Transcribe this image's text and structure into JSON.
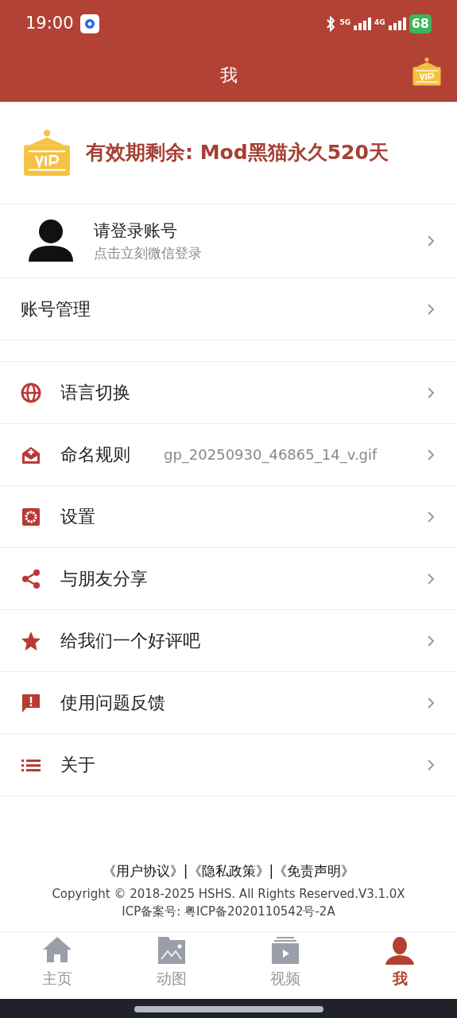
{
  "status_bar": {
    "time": "19:00",
    "networks": [
      "5G",
      "4G"
    ],
    "battery": "68"
  },
  "header": {
    "title": "我"
  },
  "vip_banner": {
    "text": "有效期剩余: Mod黑猫永久520天"
  },
  "account": {
    "title": "请登录账号",
    "subtitle": "点击立刻微信登录"
  },
  "account_manage": {
    "label": "账号管理"
  },
  "menu": [
    {
      "label": "语言切换"
    },
    {
      "label": "命名规则",
      "value": "gp_20250930_46865_14_v.gif"
    },
    {
      "label": "设置"
    },
    {
      "label": "与朋友分享"
    },
    {
      "label": "给我们一个好评吧"
    },
    {
      "label": "使用问题反馈"
    },
    {
      "label": "关于"
    }
  ],
  "footer": {
    "links": [
      "《用户协议》",
      "《隐私政策》",
      "《免责声明》"
    ],
    "separator": "|",
    "copyright": "Copyright © 2018-2025 HSHS. All Rights Reserved.V3.1.0X",
    "icp": "ICP备案号: 粤ICP备2020110542号-2A"
  },
  "tabs": [
    {
      "label": "主页",
      "selected": false
    },
    {
      "label": "动图",
      "selected": false
    },
    {
      "label": "视频",
      "selected": false
    },
    {
      "label": "我",
      "selected": true
    }
  ]
}
